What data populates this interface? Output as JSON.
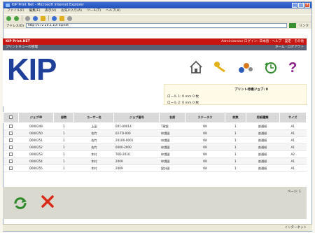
{
  "window": {
    "title": "KIP Print Net - Microsoft Internet Explorer"
  },
  "menu": [
    "ファイル(F)",
    "編集(E)",
    "表示(V)",
    "お気に入り(A)",
    "ツール(T)",
    "ヘルプ(H)"
  ],
  "address": {
    "label": "アドレス(D)",
    "value": "http://172.20.1.10/ kipnet",
    "links": "リンク"
  },
  "app": {
    "name": "KIP Print.NET",
    "user_info": "Administrator  ログイン: 日本語 · ヘルプ · 設定 · その他",
    "section": "プリントキューの管理",
    "section_right": "ホーム · ログアウト",
    "logo": "KIP"
  },
  "job_count": {
    "title": "プリント待機ジョブ: 0",
    "line1": "ロール 1: 0 mm  0 枚",
    "line2": "ロール 2: 0 mm  0 枚"
  },
  "table": {
    "headers": [
      "",
      "ジョブID",
      "部数",
      "ユーザー名",
      "ジョブ番号",
      "名前",
      "ステータス",
      "枚数",
      "用紙種類",
      "サイズ"
    ],
    "rows": [
      [
        "",
        "0000249",
        "1",
        "上田",
        "001-00014",
        "T建設",
        "OK",
        "1",
        "普通紙",
        "A1"
      ],
      [
        "",
        "0000250",
        "1",
        "佐竹",
        "02-TD-000",
        "申請図",
        "OK",
        "1",
        "普通紙",
        "A1"
      ],
      [
        "",
        "0000251",
        "1",
        "佐竹",
        "20100-0001",
        "申請図",
        "OK",
        "1",
        "普通紙",
        "A1"
      ],
      [
        "",
        "0000252",
        "1",
        "佐竹",
        "0000-2000",
        "申請図",
        "OK",
        "1",
        "普通紙",
        "A1"
      ],
      [
        "",
        "0000253",
        "1",
        "木村",
        "TKD-2010",
        "申請図",
        "OK",
        "1",
        "普通紙",
        "A2"
      ],
      [
        "",
        "0000254",
        "1",
        "木村",
        "2009",
        "申請図",
        "OK",
        "1",
        "普通紙",
        "A1"
      ],
      [
        "",
        "0000255",
        "1",
        "木村",
        "2009",
        "設計図",
        "OK",
        "1",
        "普通紙",
        "A1"
      ]
    ]
  },
  "pager": {
    "text": "ページ: 1"
  },
  "actions": {
    "refresh": "更新",
    "cancel": "キャンセル"
  },
  "status": {
    "left": "",
    "zone": "インターネット"
  },
  "colors": {
    "red": "#c8150f",
    "dark": "#5a6173",
    "logo": "#1e3f9a",
    "accent_green": "#2e8a2a"
  }
}
